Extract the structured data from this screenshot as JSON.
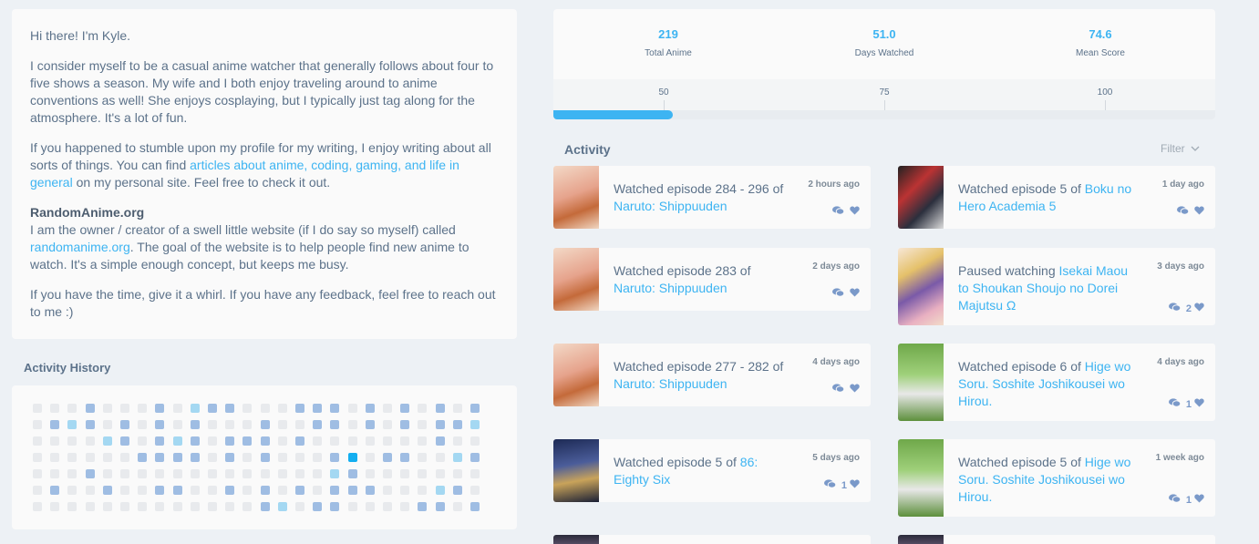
{
  "about": {
    "greeting": "Hi there! I'm Kyle.",
    "p2": "I consider myself to be a casual anime watcher that generally follows about four to five shows a season. My wife and I both enjoy traveling around to anime conventions as well! She enjoys cosplaying, but I typically just tag along for the atmosphere. It's a lot of fun.",
    "p3_before": "If you happened to stumble upon my profile for my writing, I enjoy writing about all sorts of things. You can find ",
    "p3_link": "articles about anime, coding, gaming, and life in general",
    "p3_after": " on my personal site. Feel free to check it out.",
    "site_title": "RandomAnime.org",
    "p4_before": "I am the owner / creator of a swell little website (if I do say so myself) called ",
    "p4_link": "randomanime.org",
    "p4_after": ". The goal of the website is to help people find new anime to watch. It's a simple enough concept, but keeps me busy.",
    "p5": "If you have the time, give it a whirl. If you have any feedback, feel free to reach out to me :)"
  },
  "history": {
    "title": "Activity History",
    "grid": [
      [
        0,
        0,
        0,
        2,
        0,
        0,
        0,
        2,
        0,
        3,
        2,
        2,
        0,
        0,
        0,
        2,
        2,
        2,
        0,
        2,
        0,
        2,
        0,
        2,
        0,
        2
      ],
      [
        0,
        2,
        3,
        2,
        0,
        2,
        0,
        2,
        0,
        2,
        0,
        0,
        0,
        2,
        0,
        0,
        2,
        2,
        0,
        2,
        0,
        2,
        0,
        2,
        2,
        3
      ],
      [
        0,
        0,
        0,
        0,
        3,
        2,
        0,
        2,
        3,
        2,
        0,
        2,
        2,
        2,
        0,
        2,
        0,
        0,
        0,
        0,
        0,
        0,
        0,
        2,
        0,
        0
      ],
      [
        0,
        0,
        0,
        0,
        0,
        0,
        2,
        2,
        2,
        2,
        0,
        2,
        0,
        2,
        0,
        0,
        0,
        2,
        4,
        0,
        2,
        2,
        0,
        0,
        3,
        2
      ],
      [
        0,
        0,
        0,
        2,
        0,
        0,
        0,
        0,
        0,
        0,
        0,
        0,
        0,
        0,
        0,
        0,
        0,
        3,
        2,
        0,
        0,
        0,
        0,
        0,
        0,
        0
      ],
      [
        0,
        2,
        0,
        0,
        2,
        0,
        0,
        2,
        2,
        0,
        0,
        2,
        0,
        2,
        0,
        2,
        0,
        2,
        2,
        2,
        0,
        0,
        0,
        3,
        2,
        0
      ],
      [
        0,
        0,
        0,
        0,
        0,
        0,
        0,
        0,
        0,
        0,
        0,
        0,
        0,
        2,
        3,
        0,
        2,
        2,
        0,
        0,
        0,
        0,
        2,
        2,
        0,
        2
      ]
    ]
  },
  "stats": {
    "items": [
      {
        "value": "219",
        "label": "Total Anime"
      },
      {
        "value": "51.0",
        "label": "Days Watched"
      },
      {
        "value": "74.6",
        "label": "Mean Score"
      }
    ],
    "ticks": [
      "50",
      "75",
      "100"
    ],
    "progress": 0.18
  },
  "activity": {
    "title": "Activity",
    "filter": "Filter",
    "items": [
      {
        "pre": "Watched episode 284 - 296 of ",
        "title": "Naruto: Shippuuden",
        "time": "2 hours ago",
        "likes": ""
      },
      {
        "pre": "Watched episode 5 of ",
        "title": "Boku no Hero Academia 5",
        "time": "1 day ago",
        "likes": ""
      },
      {
        "pre": "Watched episode 283 of ",
        "title": "Naruto: Shippuuden",
        "time": "2 days ago",
        "likes": ""
      },
      {
        "pre": "Paused watching ",
        "title": "Isekai Maou to Shoukan Shoujo no Dorei Majutsu Ω",
        "time": "3 days ago",
        "likes": "2"
      },
      {
        "pre": "Watched episode 277 - 282 of ",
        "title": "Naruto: Shippuuden",
        "time": "4 days ago",
        "likes": ""
      },
      {
        "pre": "Watched episode 6 of ",
        "title": "Hige wo Soru. Soshite Joshikousei wo Hirou.",
        "time": "4 days ago",
        "likes": "1"
      },
      {
        "pre": "Watched episode 5 of ",
        "title": "86: Eighty Six",
        "time": "5 days ago",
        "likes": "1"
      },
      {
        "pre": "Watched episode 5 of ",
        "title": "Hige wo Soru. Soshite Joshikousei wo Hirou.",
        "time": "1 week ago",
        "likes": "1"
      }
    ]
  }
}
